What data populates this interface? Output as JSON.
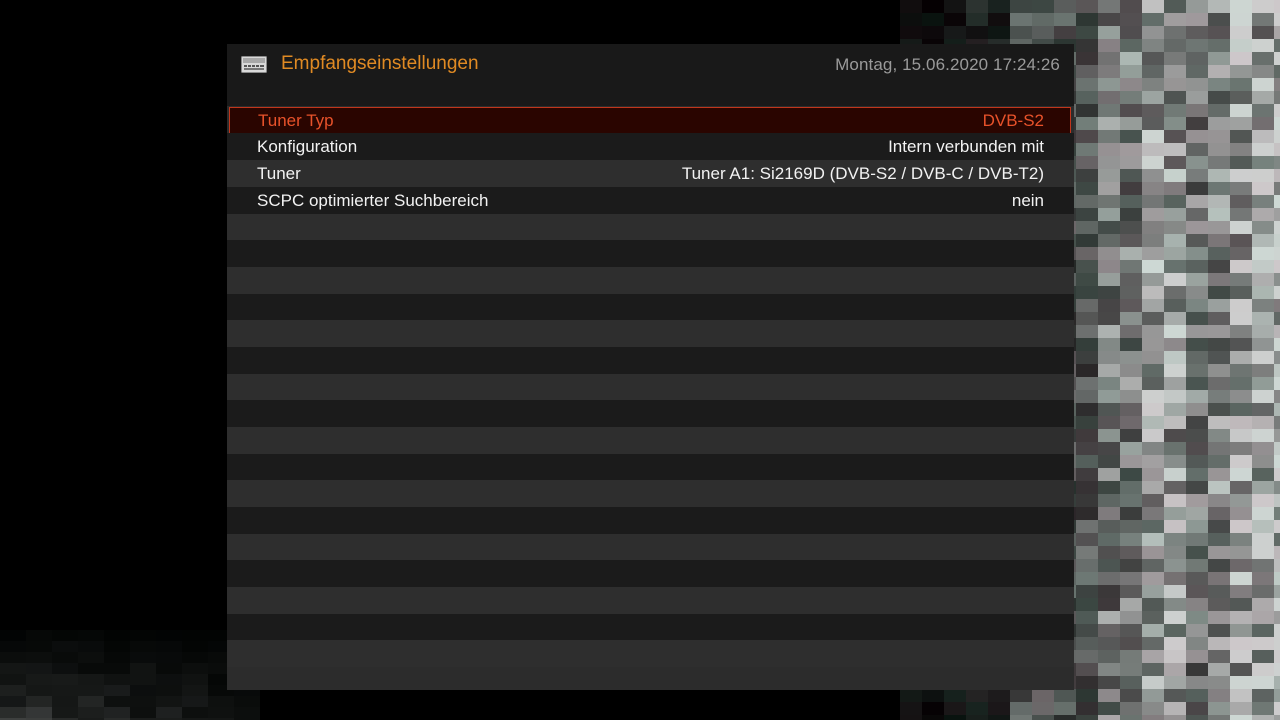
{
  "header": {
    "title": "Empfangseinstellungen",
    "clock": "Montag, 15.06.2020  17:24:26",
    "icon": "tuner-settings-icon"
  },
  "settings": [
    {
      "label": "Tuner Typ",
      "value": "DVB-S2",
      "selected": true
    },
    {
      "label": "Konfiguration",
      "value": "Intern verbunden mit",
      "selected": false
    },
    {
      "label": "Tuner",
      "value": "Tuner A1: Si2169D (DVB-S2 / DVB-C / DVB-T2)",
      "selected": false
    },
    {
      "label": "SCPC optimierter Suchbereich",
      "value": "nein",
      "selected": false
    }
  ],
  "colors": {
    "accent_title": "#e08a23",
    "selection": "#e8522a",
    "selection_border": "#c0361c"
  }
}
